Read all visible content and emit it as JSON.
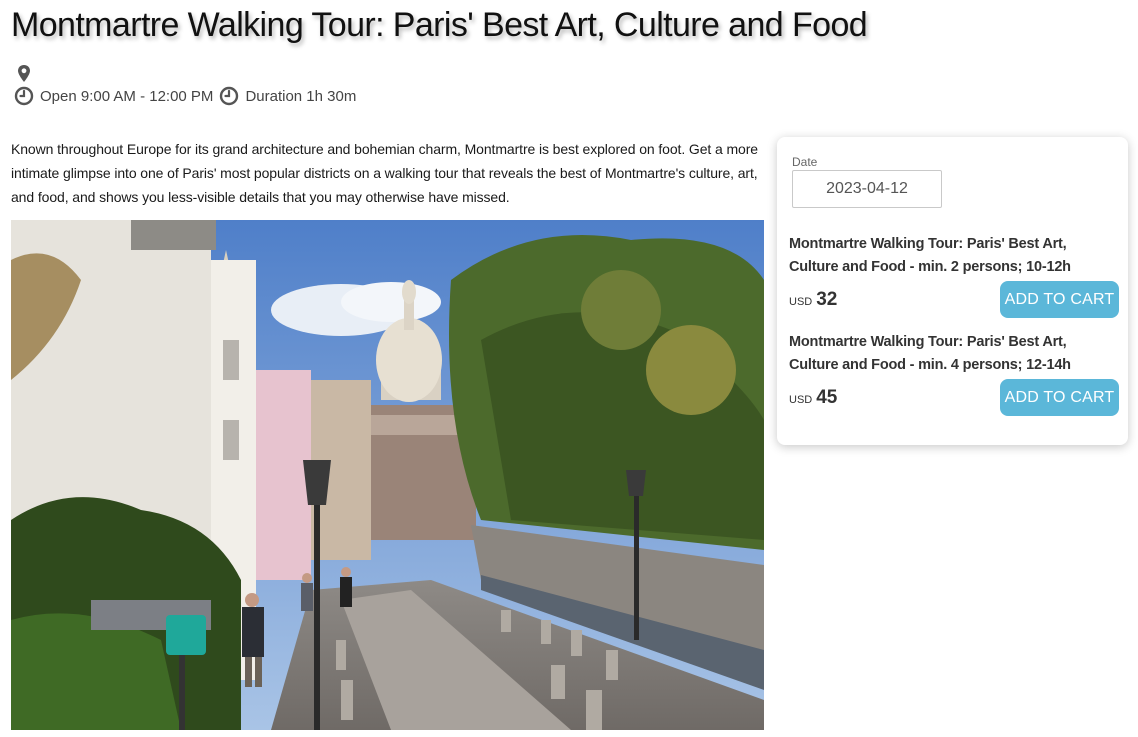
{
  "page": {
    "title": "Montmartre Walking Tour: Paris' Best Art, Culture and Food",
    "hours": "Open 9:00 AM - 12:00 PM",
    "duration": "Duration 1h 30m",
    "description": "Known throughout Europe for its grand architecture and bohemian charm, Montmartre is best explored on foot. Get a more intimate glimpse into one of Paris' most popular districts on a walking tour that reveals the best of Montmartre's culture, art, and food, and shows you less-visible details that you may otherwise have missed."
  },
  "icons": {
    "location": "map-pin-icon",
    "clock": "clock-icon"
  },
  "photo": {
    "subject": "street-photo"
  },
  "booking": {
    "date_label": "Date",
    "date_value": "2023-04-12",
    "offers": [
      {
        "title": "Montmartre Walking Tour: Paris' Best Art, Culture and Food - min. 2 persons; 10-12h",
        "currency": "USD",
        "price": "32",
        "button_label": "ADD TO CART"
      },
      {
        "title": "Montmartre Walking Tour: Paris' Best Art, Culture and Food - min. 4 persons; 12-14h",
        "currency": "USD",
        "price": "45",
        "button_label": "ADD TO CART"
      }
    ]
  },
  "colors": {
    "accent": "#5bb7d9",
    "text": "#222222"
  }
}
